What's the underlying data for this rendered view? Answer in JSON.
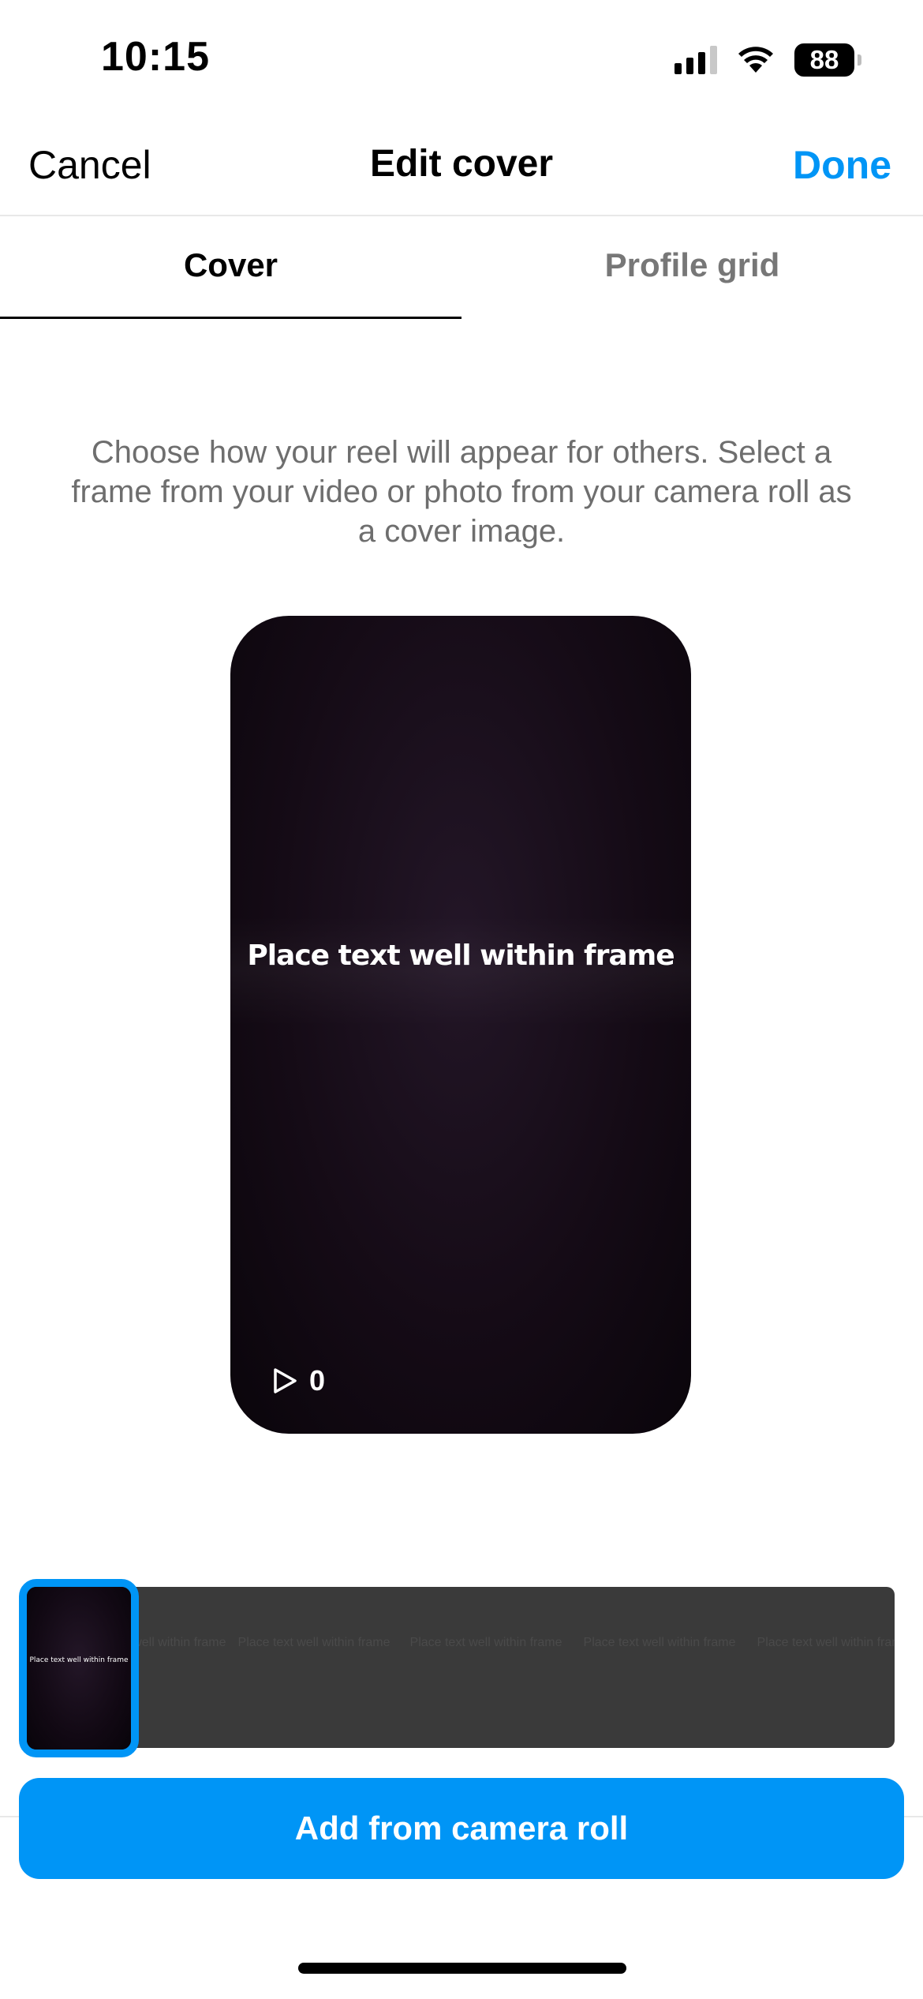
{
  "status_bar": {
    "time": "10:15",
    "battery_level": "88",
    "icons": [
      "signal-icon",
      "wifi-icon",
      "battery-icon"
    ]
  },
  "header": {
    "cancel_label": "Cancel",
    "title": "Edit cover",
    "done_label": "Done"
  },
  "tabs": [
    {
      "label": "Cover",
      "active": true
    },
    {
      "label": "Profile grid",
      "active": false
    }
  ],
  "description": "Choose how your reel will appear for others. Select a frame from your video or photo from your camera roll as a cover image.",
  "preview": {
    "overlay_text": "Place text well within frame",
    "play_count": "0",
    "icon": "play-icon"
  },
  "frame_strip": {
    "selected_frame_text": "Place text well within frame",
    "frames": [
      "Place text well within frame",
      "Place text well within frame",
      "Place text well within frame",
      "Place text well within frame",
      "Place text well within frame"
    ]
  },
  "camera_roll_button": "Add from camera roll",
  "colors": {
    "accent": "#0095f6",
    "preview_bg": "#150b16",
    "strip_bg": "#3a3a3a"
  }
}
